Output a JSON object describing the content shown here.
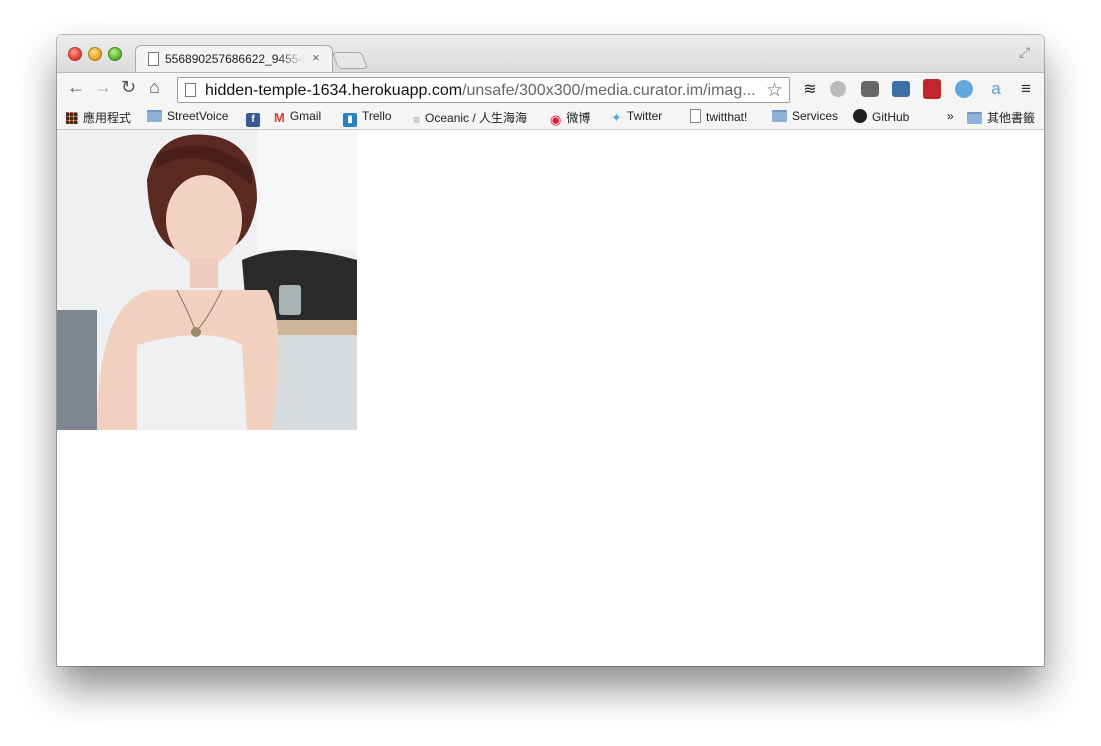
{
  "tab": {
    "title": "556890257686622_94554",
    "close": "×"
  },
  "window": {
    "fullscreen": "⤢"
  },
  "nav": {
    "back": "←",
    "forward": "→",
    "reload": "↻",
    "home": "⌂"
  },
  "omnibox": {
    "host": "hidden-temple-1634.herokuapp.com",
    "path": "/unsafe/300x300/media.curator.im/imag...",
    "star": "☆"
  },
  "extensions": [
    "stack-icon",
    "evernote-icon",
    "pocket-icon",
    "chart-icon",
    "dictionary-icon",
    "v-icon",
    "amazon-icon",
    "menu-icon"
  ],
  "bookmarks": {
    "items": [
      {
        "label": "應用程式",
        "icon": "apps-grid-icon"
      },
      {
        "label": "StreetVoice",
        "icon": "folder-icon"
      },
      {
        "label": "",
        "icon": "facebook-icon"
      },
      {
        "label": "Gmail",
        "icon": "gmail-icon"
      },
      {
        "label": "Trello",
        "icon": "trello-icon"
      },
      {
        "label": "Oceanic / 人生海海",
        "icon": "oceanic-icon"
      },
      {
        "label": "微博",
        "icon": "weibo-icon"
      },
      {
        "label": "Twitter",
        "icon": "twitter-icon"
      },
      {
        "label": "twitthat!",
        "icon": "page-icon"
      },
      {
        "label": "Services",
        "icon": "folder-icon"
      },
      {
        "label": "GitHub",
        "icon": "github-icon"
      }
    ],
    "overflow": "»",
    "other": "其他書籤"
  },
  "colors": {
    "accent": "#4a90d9",
    "close": "#e0443a",
    "minimize": "#e6a92c",
    "maximize": "#5fba35"
  }
}
